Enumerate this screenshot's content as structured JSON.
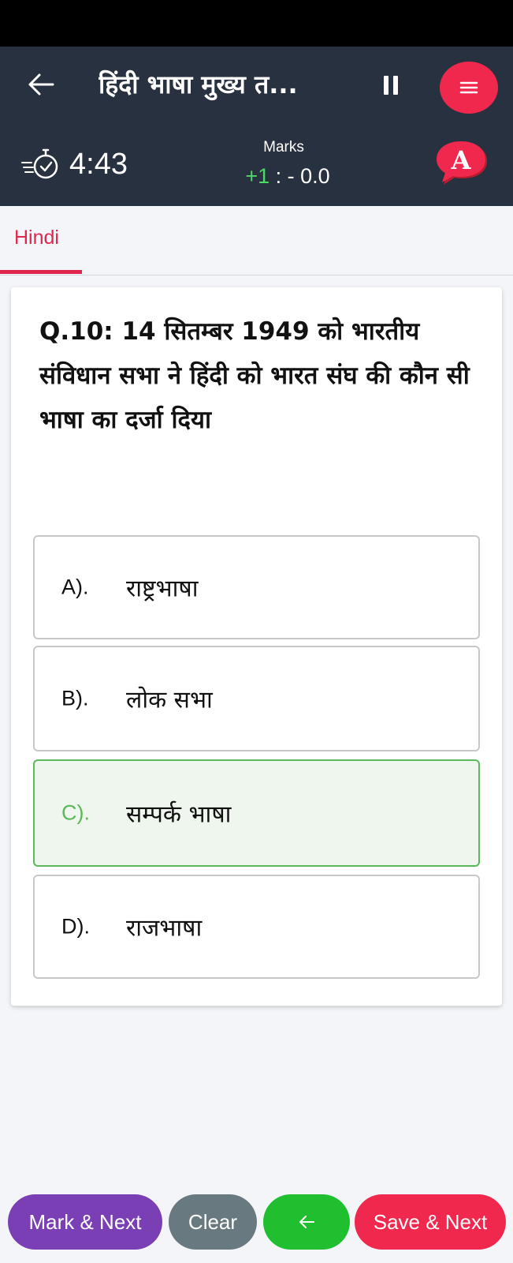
{
  "header": {
    "title": "हिंदी भाषा मुख्य त...",
    "timer": "4:43",
    "marks_label": "Marks",
    "marks_positive": "+1",
    "marks_negative": " : - 0.0",
    "language_badge": "A"
  },
  "tabs": [
    {
      "label": "Hindi",
      "active": true
    }
  ],
  "question": {
    "text": "Q.10: 14 सितम्बर 1949 को भारतीय संविधान सभा ने हिंदी को भारत संघ की कौन सी भाषा का दर्जा दिया",
    "options": [
      {
        "letter": "A).",
        "text": "राष्ट्रभाषा",
        "selected": false
      },
      {
        "letter": "B).",
        "text": "लोक सभा",
        "selected": false
      },
      {
        "letter": "C).",
        "text": "सम्पर्क भाषा",
        "selected": true
      },
      {
        "letter": "D).",
        "text": "राजभाषा",
        "selected": false
      }
    ]
  },
  "footer": {
    "mark_next": "Mark & Next",
    "clear": "Clear",
    "save_next": "Save & Next"
  },
  "colors": {
    "header_bg": "#27313f",
    "accent": "#f0284e",
    "selected_green": "#5cb85c",
    "mark_purple": "#7a3fb5",
    "clear_gray": "#68797f",
    "prev_green": "#1fbf2f"
  },
  "icons": {
    "back": "arrow-left-icon",
    "pause": "pause-icon",
    "menu": "hamburger-menu-icon",
    "timer": "stopwatch-icon",
    "language": "speech-bubble-letter-icon",
    "previous": "arrow-left-icon"
  }
}
